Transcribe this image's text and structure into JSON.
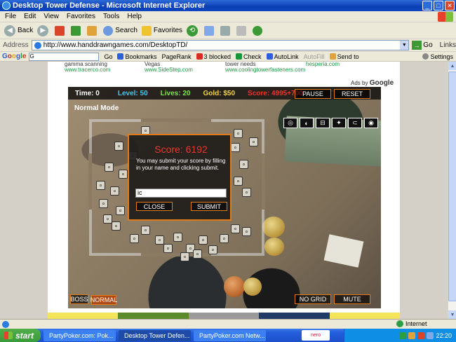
{
  "window": {
    "title": "Desktop Tower Defense - Microsoft Internet Explorer",
    "controls": {
      "minimize": "_",
      "maximize": "□",
      "close": "✕"
    }
  },
  "menu": [
    "File",
    "Edit",
    "View",
    "Favorites",
    "Tools",
    "Help"
  ],
  "toolbar": {
    "back": "Back",
    "search": "Search",
    "favorites": "Favorites"
  },
  "address": {
    "label": "Address",
    "url": "http://www.handdrawngames.com/DesktopTD/",
    "go": "Go",
    "links": "Links"
  },
  "google_toolbar": {
    "logo": [
      "G",
      "o",
      "o",
      "g",
      "l",
      "e"
    ],
    "search_value": "G",
    "go": "Go",
    "bookmarks": "Bookmarks",
    "pagerank": "PageRank",
    "blocked": "3 blocked",
    "check": "Check",
    "autolink": "AutoLink",
    "autofill": "AutoFill",
    "sendto": "Send to",
    "settings": "Settings"
  },
  "ads": [
    {
      "line1": "gamma scanning",
      "url": "www.tracerco.com"
    },
    {
      "line1": "Vegas",
      "url": "www.SideStep.com"
    },
    {
      "line1": "tower needs",
      "url": "www.coolingtowerfasteners.com"
    },
    {
      "line1": "",
      "url": "hesperia.com"
    }
  ],
  "ads_by": {
    "prefix": "Ads by",
    "brand": "Google"
  },
  "game": {
    "hud": {
      "time": "Time: 0",
      "level": "Level: 50",
      "lives": "Lives: 20",
      "gold": "Gold: $50",
      "score": "Score: 4995+700"
    },
    "pause": "PAUSE",
    "reset": "RESET",
    "mode": "Normal Mode",
    "towers": [
      "◎",
      "◐",
      "⊟",
      "✦",
      "⊂",
      "◉"
    ],
    "dialog": {
      "score": "Score: 6192",
      "message": "You may submit your score by filling in your name and clicking submit.",
      "name_value": "ic",
      "close": "CLOSE",
      "submit": "SUBMIT"
    },
    "no_grid": "NO GRID",
    "mute": "MUTE",
    "boss": "BOSS",
    "normal": "NORMAL"
  },
  "status": {
    "zone": "Internet"
  },
  "taskbar": {
    "start": "start",
    "tasks": [
      {
        "label": "PartyPoker.com: Pok...",
        "active": false
      },
      {
        "label": "Desktop Tower Defen...",
        "active": true
      },
      {
        "label": "PartyPoker.com Netw...",
        "active": false
      }
    ],
    "nero": "nero",
    "clock": "22:20"
  },
  "colors": {
    "xp_blue": "#0a3fb3",
    "game_orange": "#e07a1b",
    "score_red": "#e8352a",
    "level_cyan": "#44c7f0",
    "lives_green": "#7fe84a",
    "gold_yellow": "#f0d54a"
  }
}
